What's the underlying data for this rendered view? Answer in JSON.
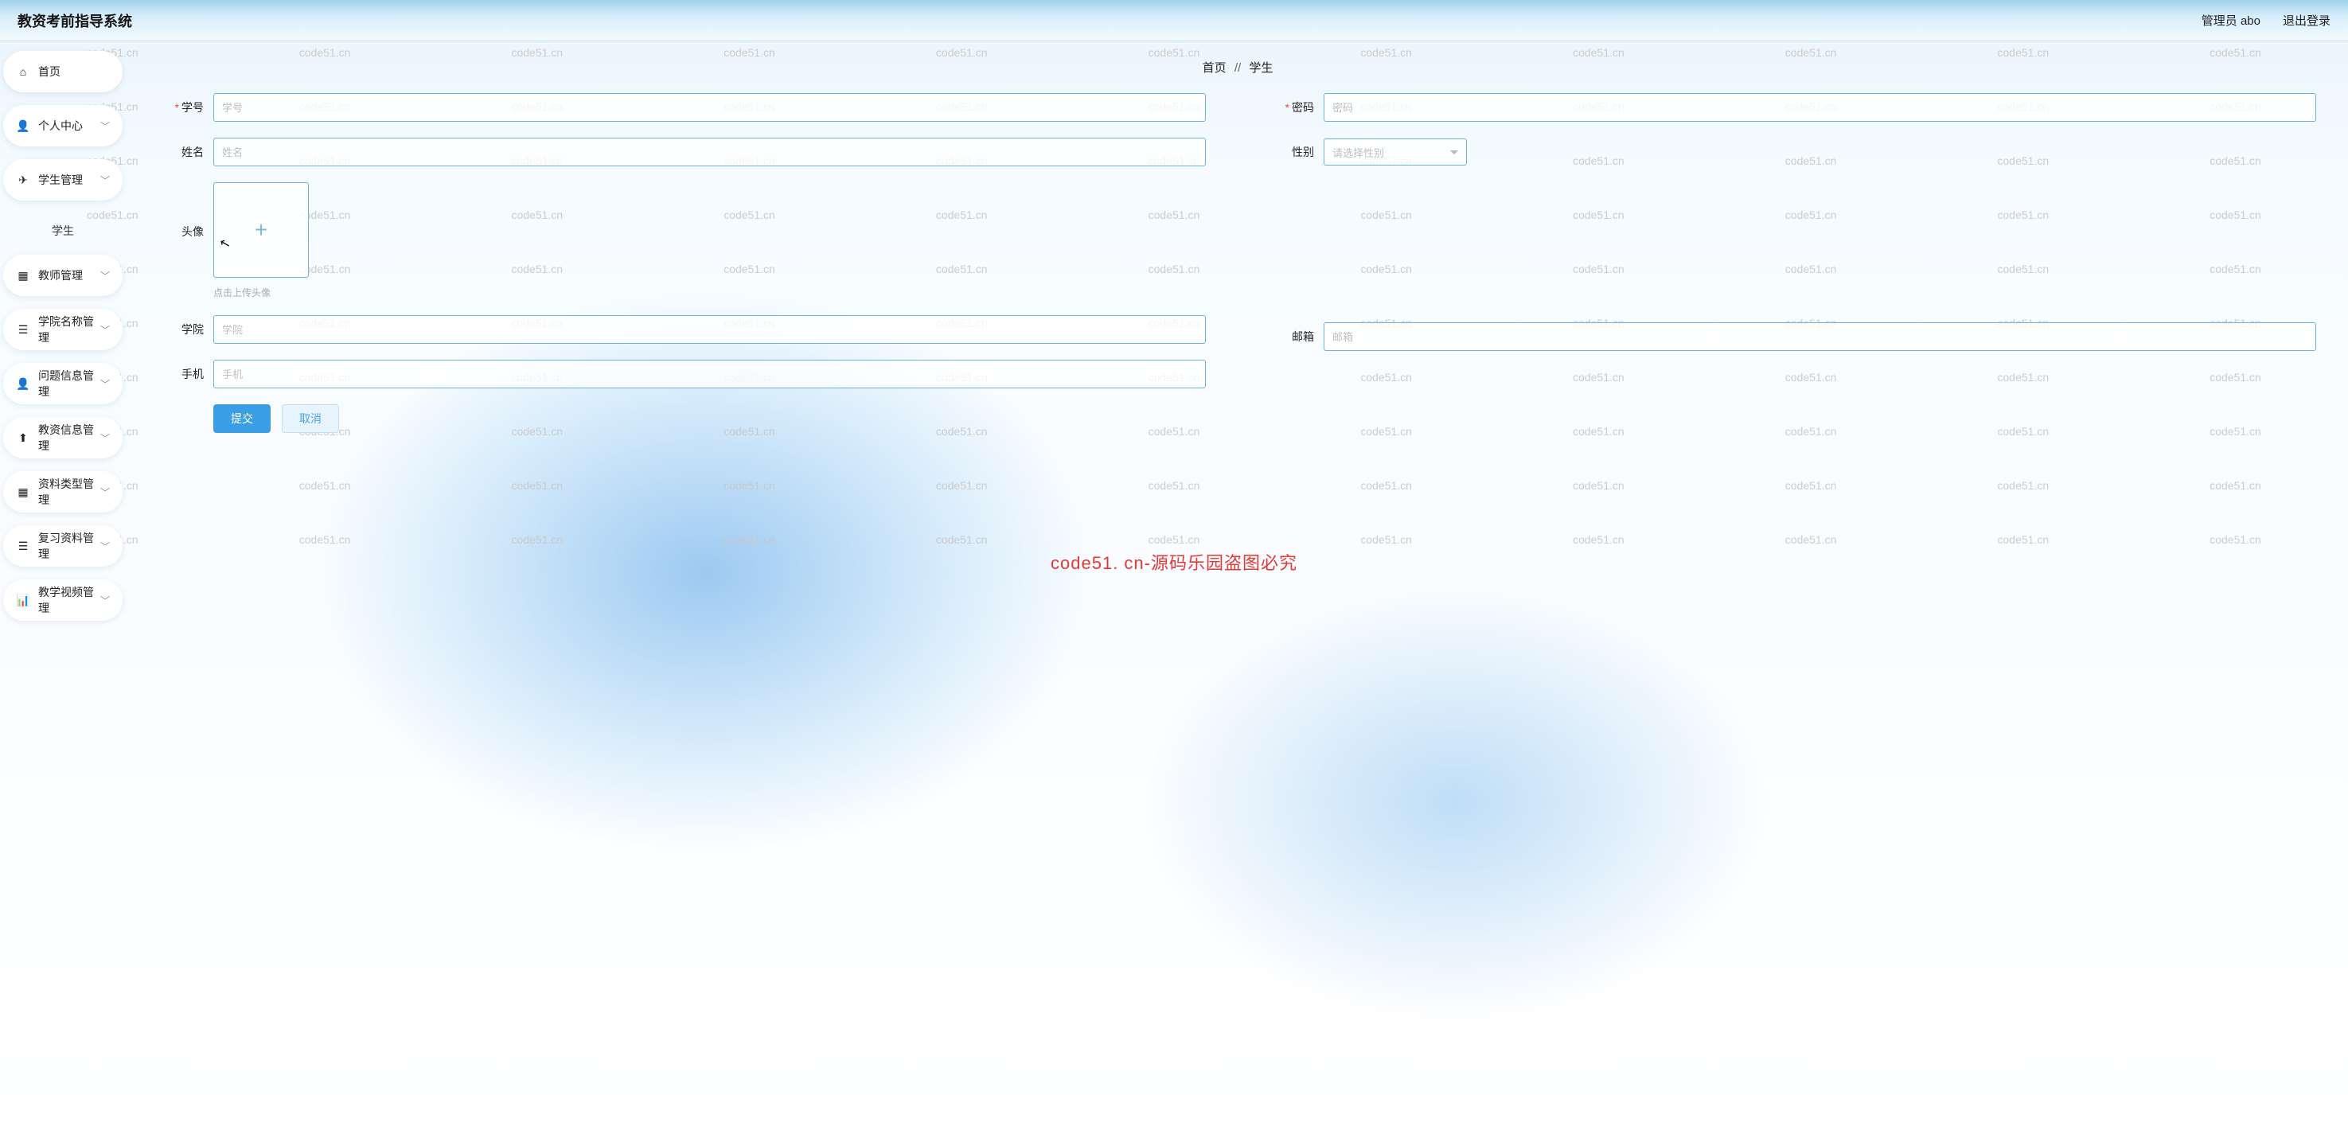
{
  "watermark": {
    "text": "code51.cn",
    "overlay": "code51. cn-源码乐园盗图必究"
  },
  "header": {
    "title": "教资考前指导系统",
    "admin_label": "管理员 abo",
    "logout_label": "退出登录"
  },
  "sidebar": {
    "items": [
      {
        "icon": "home",
        "label": "首页",
        "expandable": false
      },
      {
        "icon": "person",
        "label": "个人中心",
        "expandable": true
      },
      {
        "icon": "send",
        "label": "学生管理",
        "expandable": true,
        "children": [
          {
            "label": "学生"
          }
        ]
      },
      {
        "icon": "grid",
        "label": "教师管理",
        "expandable": true
      },
      {
        "icon": "list",
        "label": "学院名称管理",
        "expandable": true
      },
      {
        "icon": "person",
        "label": "问题信息管理",
        "expandable": true
      },
      {
        "icon": "upload",
        "label": "教资信息管理",
        "expandable": true
      },
      {
        "icon": "grid",
        "label": "资料类型管理",
        "expandable": true
      },
      {
        "icon": "list",
        "label": "复习资料管理",
        "expandable": true
      },
      {
        "icon": "bars",
        "label": "教学视频管理",
        "expandable": true
      }
    ]
  },
  "breadcrumb": {
    "home": "首页",
    "sep": "//",
    "current": "学生"
  },
  "form": {
    "left": {
      "student_id": {
        "label": "学号",
        "required": true,
        "placeholder": "学号",
        "value": ""
      },
      "name": {
        "label": "姓名",
        "required": false,
        "placeholder": "姓名",
        "value": ""
      },
      "avatar": {
        "label": "头像",
        "hint": "点击上传头像"
      },
      "college": {
        "label": "学院",
        "required": false,
        "placeholder": "学院",
        "value": ""
      },
      "phone": {
        "label": "手机",
        "required": false,
        "placeholder": "手机",
        "value": ""
      }
    },
    "right": {
      "password": {
        "label": "密码",
        "required": true,
        "placeholder": "密码",
        "value": ""
      },
      "gender": {
        "label": "性别",
        "placeholder": "请选择性别",
        "value": ""
      },
      "email": {
        "label": "邮箱",
        "placeholder": "邮箱",
        "value": ""
      }
    },
    "actions": {
      "submit": "提交",
      "cancel": "取消"
    }
  },
  "icons": {
    "home": "⌂",
    "person": "👤",
    "send": "✈",
    "grid": "▦",
    "list": "☰",
    "upload": "⬆",
    "bars": "📊",
    "chev": "﹀"
  }
}
